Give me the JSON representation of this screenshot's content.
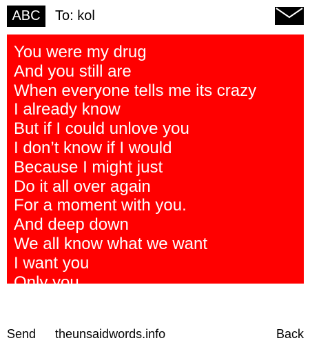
{
  "header": {
    "input_mode": "ABC",
    "recipient": "To: kol",
    "icon": "envelope-icon"
  },
  "message": {
    "background_color": "#ff0000",
    "text_color": "#ffffff",
    "lines": [
      "You were my drug",
      "And you still are",
      "When everyone tells me its crazy",
      "I already know",
      "But if I could unlove you",
      "I don’t know if I would",
      "Because I might just",
      "Do it all over again",
      "For a moment with you.",
      "And deep down",
      "We all know what we want",
      "I want you",
      "Only you"
    ]
  },
  "footer": {
    "send_label": "Send",
    "site_label": "theunsaidwords.info",
    "back_label": "Back"
  }
}
